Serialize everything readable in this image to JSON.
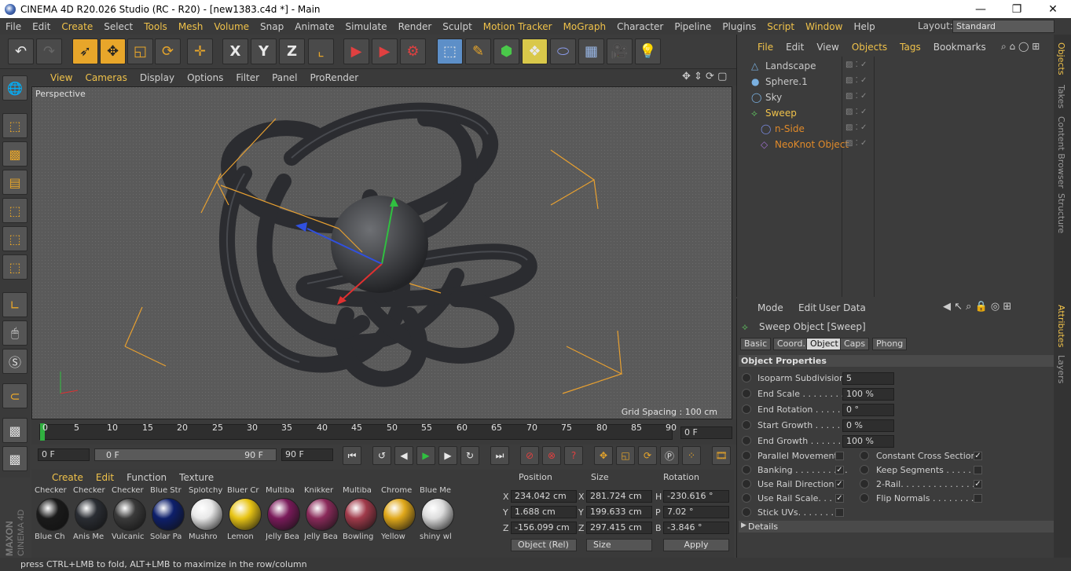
{
  "window": {
    "title": "CINEMA 4D R20.026 Studio (RC - R20) - [new1383.c4d *] - Main",
    "minimize": "—",
    "maximize": "❐",
    "close": "✕"
  },
  "menubar": {
    "items": [
      "File",
      "Edit",
      "Create",
      "Select",
      "Tools",
      "Mesh",
      "Volume",
      "Snap",
      "Animate",
      "Simulate",
      "Render",
      "Sculpt",
      "Motion Tracker",
      "MoGraph",
      "Character",
      "Pipeline",
      "Plugins",
      "Script",
      "Window",
      "Help"
    ],
    "layout_label": "Layout:",
    "layout_value": "Standard"
  },
  "toolbar": {
    "axis_x": "X",
    "axis_y": "Y",
    "axis_z": "Z"
  },
  "viewport": {
    "menu": [
      "View",
      "Cameras",
      "Display",
      "Options",
      "Filter",
      "Panel",
      "ProRender"
    ],
    "label": "Perspective",
    "grid_spacing": "Grid Spacing : 100 cm"
  },
  "timeline": {
    "ticks": [
      "0",
      "5",
      "10",
      "15",
      "20",
      "25",
      "30",
      "35",
      "40",
      "45",
      "50",
      "55",
      "60",
      "65",
      "70",
      "75",
      "80",
      "85",
      "90"
    ],
    "current_frame": "0 F",
    "start": "0 F",
    "slider_left": "0 F",
    "slider_right": "90 F",
    "end": "90 F"
  },
  "materials": {
    "menu": [
      "Create",
      "Edit",
      "Function",
      "Texture"
    ],
    "items": [
      {
        "top": "Checker",
        "name": "Blue Ch",
        "color": "#1a1a1a"
      },
      {
        "top": "Checker",
        "name": "Anis Me",
        "color": "#2a2d33"
      },
      {
        "top": "Checker",
        "name": "Vulcanic",
        "color": "#3a3a3a"
      },
      {
        "top": "Blue Str",
        "name": "Solar Pa",
        "color": "#0d1f6b"
      },
      {
        "top": "Splotchy",
        "name": "Mushro",
        "color": "#e8e8e8"
      },
      {
        "top": "Bluer Cr",
        "name": "Lemon",
        "color": "#e8c414"
      },
      {
        "top": "Multiba",
        "name": "Jelly Bea",
        "color": "#7a1a5a"
      },
      {
        "top": "Knikker",
        "name": "Jelly Bea",
        "color": "#8a2a5a"
      },
      {
        "top": "Multiba",
        "name": "Bowling",
        "color": "#a03a4a"
      },
      {
        "top": "Chrome",
        "name": "Yellow",
        "color": "#e0a81a"
      },
      {
        "top": "Blue Me",
        "name": "shiny wl",
        "color": "#dcdcdc"
      }
    ]
  },
  "coordinates": {
    "headers": [
      "Position",
      "Size",
      "Rotation"
    ],
    "rows": [
      {
        "axis": "X",
        "pos": "234.042 cm",
        "size_axis": "X",
        "size": "281.724 cm",
        "rot_axis": "H",
        "rot": "-230.616 °"
      },
      {
        "axis": "Y",
        "pos": "1.688 cm",
        "size_axis": "Y",
        "size": "199.633 cm",
        "rot_axis": "P",
        "rot": "7.02 °"
      },
      {
        "axis": "Z",
        "pos": "-156.099 cm",
        "size_axis": "Z",
        "size": "297.415 cm",
        "rot_axis": "B",
        "rot": "-3.846 °"
      }
    ],
    "mode": "Object (Rel)",
    "size_mode": "Size",
    "apply": "Apply"
  },
  "objects": {
    "menu": [
      "File",
      "Edit",
      "View",
      "Objects",
      "Tags",
      "Bookmarks"
    ],
    "items": [
      {
        "name": "Landscape",
        "color": "#c8c8c8",
        "indent": 0
      },
      {
        "name": "Sphere.1",
        "color": "#c8c8c8",
        "indent": 0
      },
      {
        "name": "Sky",
        "color": "#c8c8c8",
        "indent": 0
      },
      {
        "name": "Sweep",
        "color": "#f0c24a",
        "indent": 0
      },
      {
        "name": "n-Side",
        "color": "#e08a2a",
        "indent": 1
      },
      {
        "name": "NeoKnot Object",
        "color": "#e08a2a",
        "indent": 1
      }
    ]
  },
  "right_tabs": [
    "Objects",
    "Takes",
    "Content Browser",
    "Structure",
    "Attributes",
    "Layers"
  ],
  "attributes": {
    "menu": [
      "Mode",
      "Edit",
      "User Data"
    ],
    "title": "Sweep Object [Sweep]",
    "tabs": [
      "Basic",
      "Coord.",
      "Object",
      "Caps",
      "Phong"
    ],
    "section": "Object Properties",
    "fields": [
      {
        "label": "Isoparm Subdivision",
        "value": "5"
      },
      {
        "label": "End Scale . . . . . . . . . .",
        "value": "100 %"
      },
      {
        "label": "End Rotation . . . . . . .",
        "value": "0 °"
      },
      {
        "label": "Start Growth . . . . . . .",
        "value": "0 %"
      },
      {
        "label": "End Growth . . . . . . . .",
        "value": "100 %"
      }
    ],
    "checks_left": [
      {
        "label": "Parallel Movement",
        "checked": ""
      },
      {
        "label": "Banking . . . . . . . . . .",
        "checked": "✓"
      },
      {
        "label": "Use Rail Direction",
        "checked": "✓"
      },
      {
        "label": "Use Rail Scale. . . . .",
        "checked": "✓"
      },
      {
        "label": "Stick UVs. . . . . . . . .",
        "checked": ""
      }
    ],
    "checks_right": [
      {
        "label": "Constant Cross Section",
        "checked": "✓"
      },
      {
        "label": "Keep Segments . . . . . .",
        "checked": ""
      },
      {
        "label": "2-Rail. . . . . . . . . . . . . . .",
        "checked": "✓"
      },
      {
        "label": "Flip Normals . . . . . . . . .",
        "checked": ""
      }
    ],
    "details": "Details"
  },
  "status": "press CTRL+LMB to fold, ALT+LMB to maximize in the row/column"
}
